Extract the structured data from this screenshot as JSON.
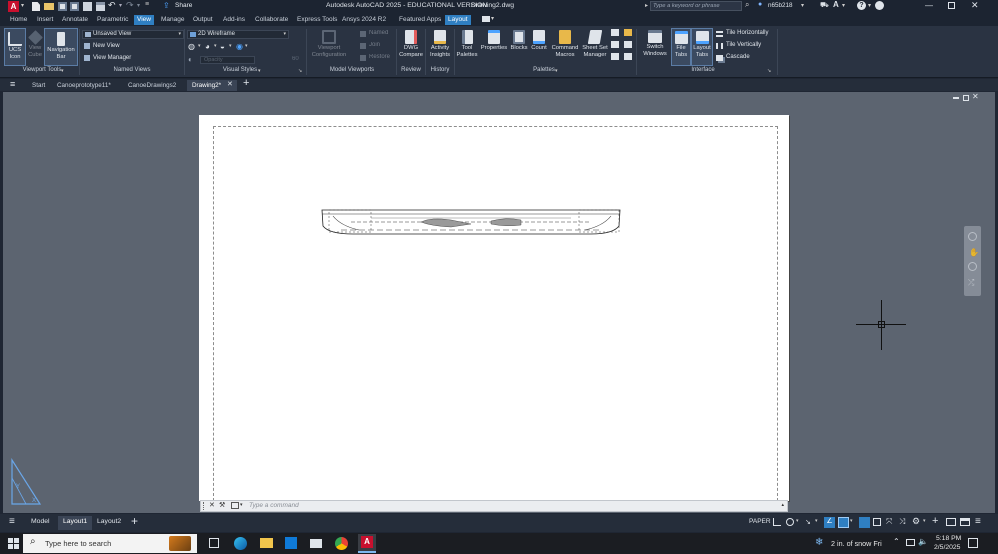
{
  "titlebar": {
    "app_letter": "A",
    "share_label": "Share",
    "title": "Autodesk AutoCAD 2025 - EDUCATIONAL VERSION",
    "filename": "Drawing2.dwg",
    "search_placeholder": "Type a keyword or phrase",
    "username": "n65b218"
  },
  "ribbon_tabs": [
    "Home",
    "Insert",
    "Annotate",
    "Parametric",
    "View",
    "Manage",
    "Output",
    "Add-ins",
    "Collaborate",
    "Express Tools",
    "Ansys 2024 R2",
    "Featured Apps",
    "Layout"
  ],
  "ribbon": {
    "ucs_icon": "UCS Icon",
    "view_cube": "View Cube",
    "navigation_bar": "Navigation Bar",
    "viewport_tools_label": "Viewport Tools",
    "unsaved_view": "Unsaved View",
    "new_view": "New View",
    "view_manager": "View Manager",
    "named_views_label": "Named Views",
    "visual_style": "2D Wireframe",
    "opacity_placeholder": "Opacity",
    "opacity_value": "60",
    "visual_styles_label": "Visual Styles",
    "viewport_configuration": "Viewport Configuration",
    "named": "Named",
    "join": "Join",
    "restore": "Restore",
    "model_viewports_label": "Model Viewports",
    "dwg_compare": "DWG Compare",
    "review_label": "Review",
    "activity_insights": "Activity Insights",
    "history_label": "History",
    "tool_palettes": "Tool Palettes",
    "properties": "Properties",
    "blocks": "Blocks",
    "count": "Count",
    "command_macros": "Command Macros",
    "sheet_set_manager": "Sheet Set Manager",
    "palettes_label": "Palettes",
    "switch_windows": "Switch Windows",
    "file_tabs": "File Tabs",
    "layout_tabs": "Layout Tabs",
    "tile_horizontally": "Tile Horizontally",
    "tile_vertically": "Tile Vertically",
    "cascade": "Cascade",
    "interface_label": "Interface"
  },
  "file_tabs": [
    "Start",
    "Canoeprototype11*",
    "CanoeDrawings2",
    "Drawing2*"
  ],
  "command": {
    "placeholder": "Type a command"
  },
  "layout_tabs": [
    "Model",
    "Layout1",
    "Layout2"
  ],
  "status": {
    "paper": "PAPER"
  },
  "taskbar": {
    "search_placeholder": "Type here to search",
    "weather": "2 in. of snow Fri",
    "time": "5:18 PM",
    "date": "2/5/2025"
  },
  "colors": {
    "accent": "#2f7fc2",
    "ribbon_bg": "#2a3342",
    "draw_bg": "#5c6470"
  }
}
